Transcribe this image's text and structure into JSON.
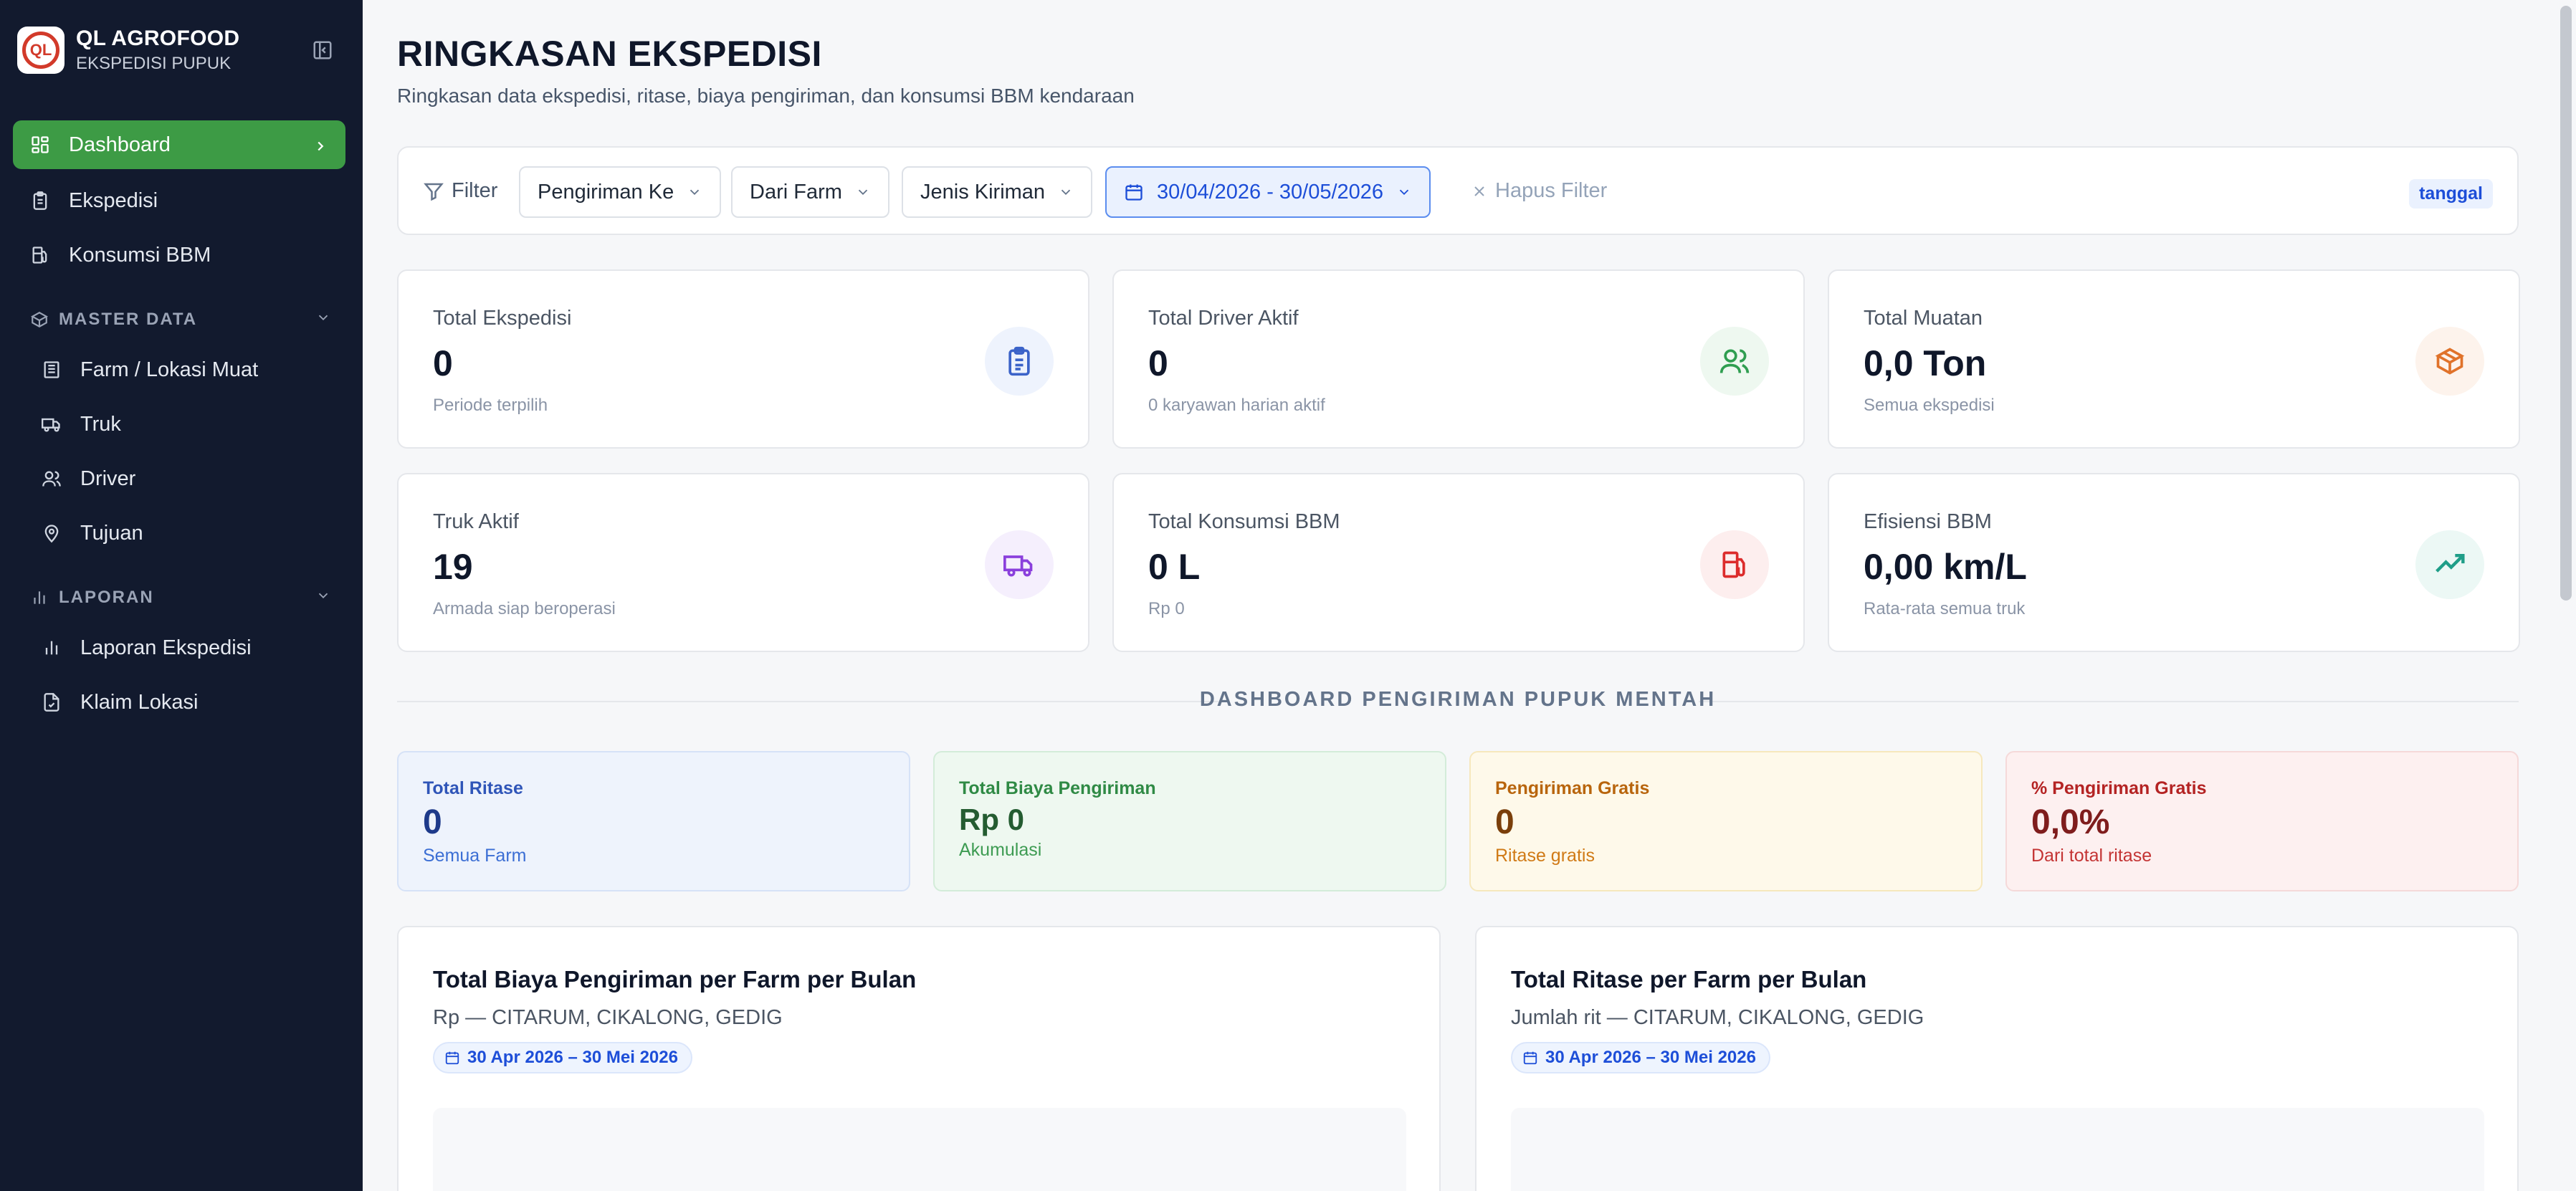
{
  "brand": {
    "logo_text": "QL",
    "title": "QL AGROFOOD",
    "subtitle": "EKSPEDISI PUPUK"
  },
  "sidebar": {
    "items": [
      {
        "label": "Dashboard",
        "icon": "dashboard-icon",
        "active": true
      },
      {
        "label": "Ekspedisi",
        "icon": "clipboard-icon"
      },
      {
        "label": "Konsumsi BBM",
        "icon": "fuel-icon"
      }
    ],
    "sections": [
      {
        "label": "MASTER DATA",
        "icon": "box-icon",
        "items": [
          {
            "label": "Farm / Lokasi Muat",
            "icon": "building-icon"
          },
          {
            "label": "Truk",
            "icon": "truck-icon"
          },
          {
            "label": "Driver",
            "icon": "users-icon"
          },
          {
            "label": "Tujuan",
            "icon": "map-pin-icon"
          }
        ]
      },
      {
        "label": "LAPORAN",
        "icon": "bar-chart-icon",
        "items": [
          {
            "label": "Laporan Ekspedisi",
            "icon": "bar-chart-icon"
          },
          {
            "label": "Klaim Lokasi",
            "icon": "file-check-icon"
          }
        ]
      }
    ]
  },
  "header": {
    "title": "RINGKASAN EKSPEDISI",
    "subtitle": "Ringkasan data ekspedisi, ritase, biaya pengiriman, dan konsumsi BBM kendaraan"
  },
  "filters": {
    "label": "Filter",
    "dropdowns": [
      "Pengiriman Ke",
      "Dari Farm",
      "Jenis Kiriman"
    ],
    "date_range": "30/04/2026 - 30/05/2026",
    "clear_label": "Hapus Filter",
    "tag": "tanggal"
  },
  "stats": [
    {
      "label": "Total Ekspedisi",
      "value": "0",
      "sub": "Periode terpilih",
      "icon": "clipboard-list-icon",
      "color": "#3b63c9",
      "bg": "#eef3fd"
    },
    {
      "label": "Total Driver Aktif",
      "value": "0",
      "sub": "0 karyawan harian aktif",
      "icon": "users-icon",
      "color": "#2f9e50",
      "bg": "#eef8f0"
    },
    {
      "label": "Total Muatan",
      "value": "0,0 Ton",
      "sub": "Semua ekspedisi",
      "icon": "package-icon",
      "color": "#e0722a",
      "bg": "#fdf3ec"
    },
    {
      "label": "Truk Aktif",
      "value": "19",
      "sub": "Armada siap beroperasi",
      "icon": "truck-icon",
      "color": "#8a3fdc",
      "bg": "#f5effd"
    },
    {
      "label": "Total Konsumsi BBM",
      "value": "0 L",
      "sub": "Rp 0",
      "icon": "fuel-icon",
      "color": "#dc2c2c",
      "bg": "#fdeeee"
    },
    {
      "label": "Efisiensi BBM",
      "value": "0,00 km/L",
      "sub": "Rata-rata semua truk",
      "icon": "trending-up-icon",
      "color": "#1f9e88",
      "bg": "#ecf8f5"
    }
  ],
  "section_title": "DASHBOARD PENGIRIMAN PUPUK MENTAH",
  "mini_stats": [
    {
      "label": "Total Ritase",
      "value": "0",
      "sub": "Semua Farm",
      "bg": "#eef3fc",
      "border": "#d6e2f7",
      "label_color": "#2f55b8",
      "value_color": "#1e3a8a",
      "sub_color": "#3b6ed4"
    },
    {
      "label": "Total Biaya Pengiriman",
      "value": "Rp 0",
      "sub": "Akumulasi",
      "bg": "#eef8f0",
      "border": "#d3ecd9",
      "label_color": "#2f8a45",
      "value_color": "#245c31",
      "sub_color": "#3d9b52"
    },
    {
      "label": "Pengiriman Gratis",
      "value": "0",
      "sub": "Ritase gratis",
      "bg": "#fef9ea",
      "border": "#f6e8bd",
      "label_color": "#b8650d",
      "value_color": "#7a3f0b",
      "sub_color": "#d07a16"
    },
    {
      "label": "% Pengiriman Gratis",
      "value": "0,0%",
      "sub": "Dari total ritase",
      "bg": "#fdf0f0",
      "border": "#f5d9d9",
      "label_color": "#b42323",
      "value_color": "#7f1d1d",
      "sub_color": "#c43434"
    }
  ],
  "charts": [
    {
      "title": "Total Biaya Pengiriman per Farm per Bulan",
      "subtitle": "Rp — CITARUM, CIKALONG, GEDIG",
      "range": "30 Apr 2026 – 30 Mei 2026"
    },
    {
      "title": "Total Ritase per Farm per Bulan",
      "subtitle": "Jumlah rit — CITARUM, CIKALONG, GEDIG",
      "range": "30 Apr 2026 – 30 Mei 2026"
    }
  ]
}
